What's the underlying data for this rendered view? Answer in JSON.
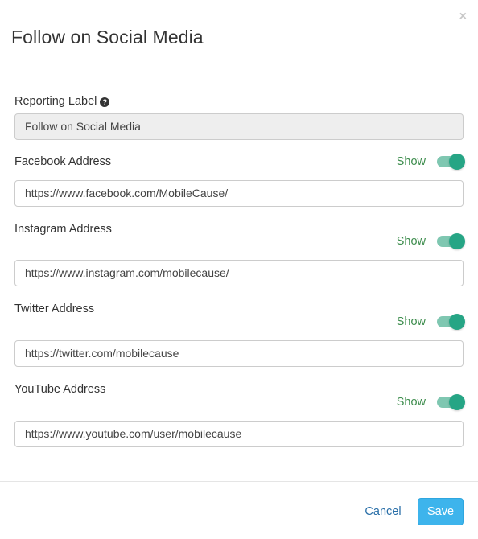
{
  "modal": {
    "title": "Follow on Social Media",
    "close_glyph": "×"
  },
  "form": {
    "reporting_label": {
      "label": "Reporting Label",
      "help_icon": "?",
      "value": "Follow on Social Media"
    },
    "fields": [
      {
        "label": "Facebook Address",
        "show_label": "Show",
        "show_enabled": true,
        "value": "https://www.facebook.com/MobileCause/"
      },
      {
        "label": "Instagram Address",
        "show_label": "Show",
        "show_enabled": true,
        "value": "https://www.instagram.com/mobilecause/"
      },
      {
        "label": "Twitter Address",
        "show_label": "Show",
        "show_enabled": true,
        "value": "https://twitter.com/mobilecause"
      },
      {
        "label": "YouTube Address",
        "show_label": "Show",
        "show_enabled": true,
        "value": "https://www.youtube.com/user/mobilecause"
      }
    ]
  },
  "footer": {
    "cancel_label": "Cancel",
    "save_label": "Save"
  },
  "colors": {
    "toggle_on": "#26a585",
    "toggle_track": "#7fc7b1",
    "show_text": "#3c8c4c",
    "save_button": "#3db4ec",
    "cancel_link": "#2a6fa8"
  }
}
